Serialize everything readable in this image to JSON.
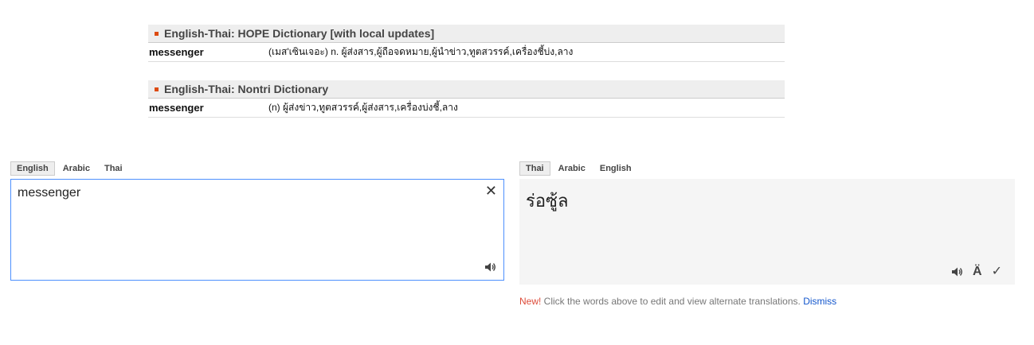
{
  "dictionaries": [
    {
      "title": "English-Thai: HOPE Dictionary [with local updates]",
      "word": "messenger",
      "definition": "(เมส'เซินเจอะ) n. ผู้ส่งสาร,ผู้ถือจดหมาย,ผู้นำข่าว,ทูตสวรรค์,เครื่องชี้บ่ง,ลาง"
    },
    {
      "title": "English-Thai: Nontri Dictionary",
      "word": "messenger",
      "definition": "(n) ผู้ส่งข่าว,ทูตสวรรค์,ผู้ส่งสาร,เครื่องบ่งชี้,ลาง"
    }
  ],
  "source": {
    "languages": [
      "English",
      "Arabic",
      "Thai"
    ],
    "active": "English",
    "text": "messenger",
    "clear_symbol": "✕"
  },
  "target": {
    "languages": [
      "Thai",
      "Arabic",
      "English"
    ],
    "active": "Thai",
    "text": "ร่อซู้ล",
    "phonetic_symbol": "Ä",
    "check_symbol": "✓"
  },
  "notice": {
    "new_label": "New!",
    "message": " Click the words above to edit and view alternate translations. ",
    "dismiss_label": "Dismiss"
  },
  "colors": {
    "accent_orange": "#dd4b10",
    "input_border": "#4d90fe",
    "link_blue": "#1155cc",
    "new_red": "#dd4b39"
  }
}
